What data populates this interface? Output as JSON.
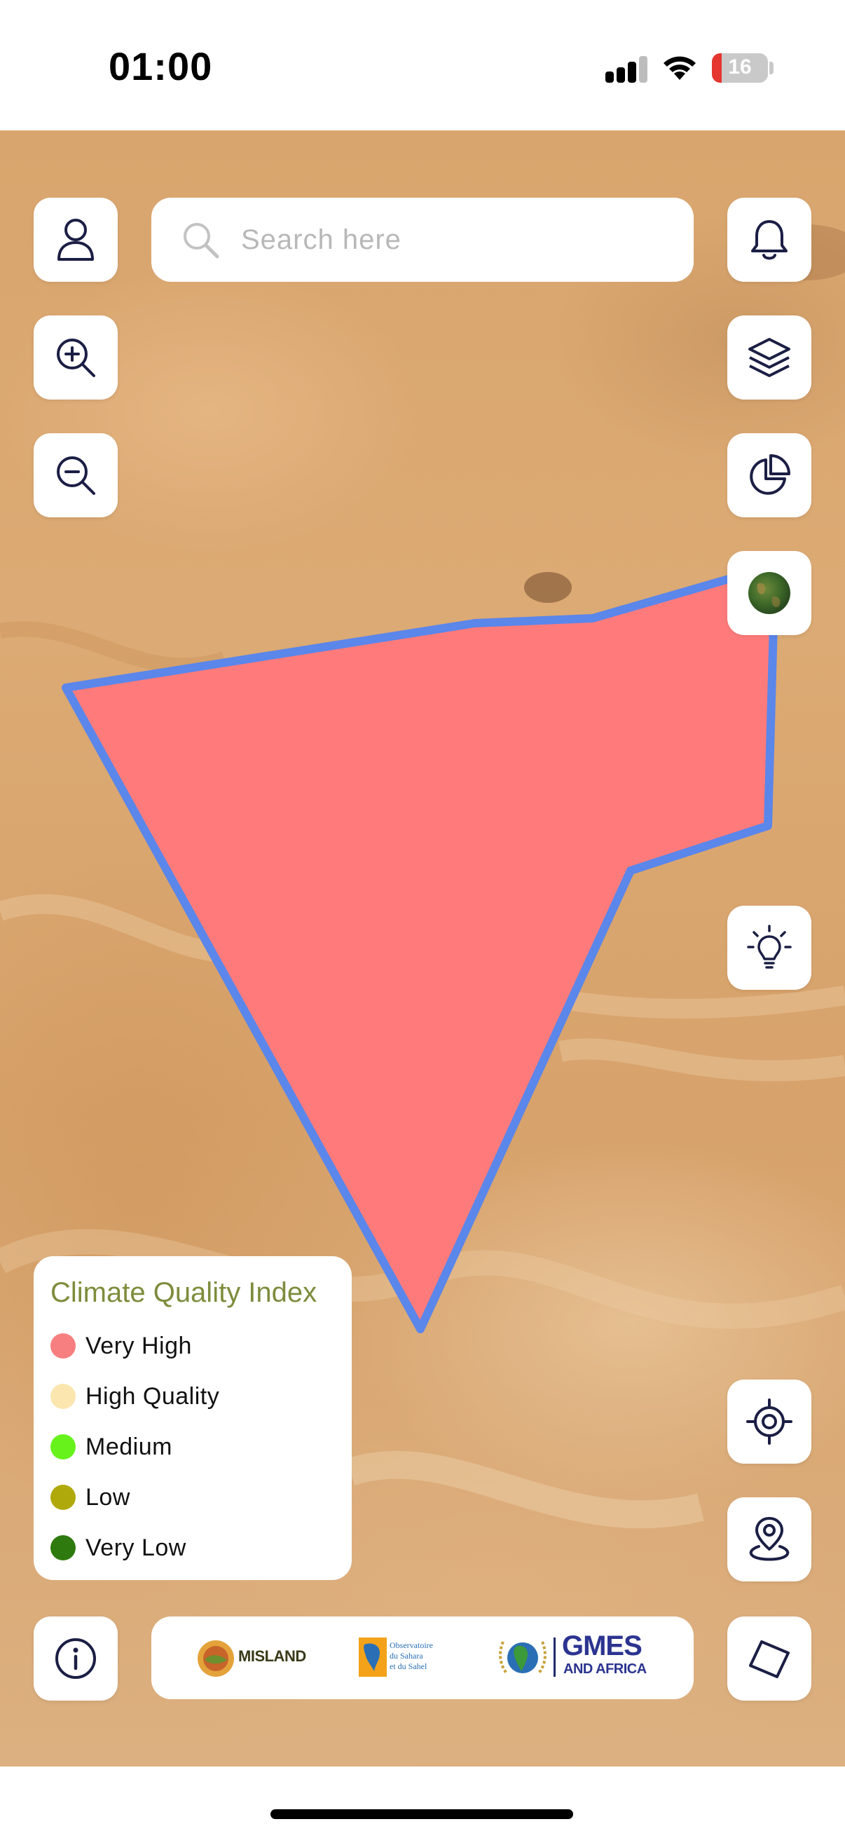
{
  "status_bar": {
    "time": "01:00",
    "battery": "16"
  },
  "search": {
    "placeholder": "Search here"
  },
  "icons": {
    "profile": "user-icon",
    "zoom_in": "zoom-in-icon",
    "zoom_out": "zoom-out-icon",
    "notifications": "bell-icon",
    "layers": "layers-icon",
    "stats": "pie-chart-icon",
    "basemap": "satellite-thumbnail-icon",
    "tips": "lightbulb-icon",
    "locate": "crosshair-icon",
    "pin": "map-pin-icon",
    "draw": "polygon-draw-icon",
    "info": "info-icon"
  },
  "legend": {
    "title": "Climate Quality Index",
    "items": [
      {
        "label": "Very High",
        "color": "#f77f7f"
      },
      {
        "label": "High Quality",
        "color": "#fbe6b0"
      },
      {
        "label": "Medium",
        "color": "#66f21a"
      },
      {
        "label": "Low",
        "color": "#b0a90c"
      },
      {
        "label": "Very Low",
        "color": "#2f7a0e"
      }
    ]
  },
  "polygon": {
    "fill": "#ff7b7b",
    "stroke": "#5b86ea",
    "class": "Very High"
  },
  "logos": {
    "misland": "MISLAND",
    "oss_line1": "Observatoire",
    "oss_line2": "du Sahara",
    "oss_line3": "et du Sahel",
    "gmes_line1": "GMES",
    "gmes_line2": "AND AFRICA"
  }
}
